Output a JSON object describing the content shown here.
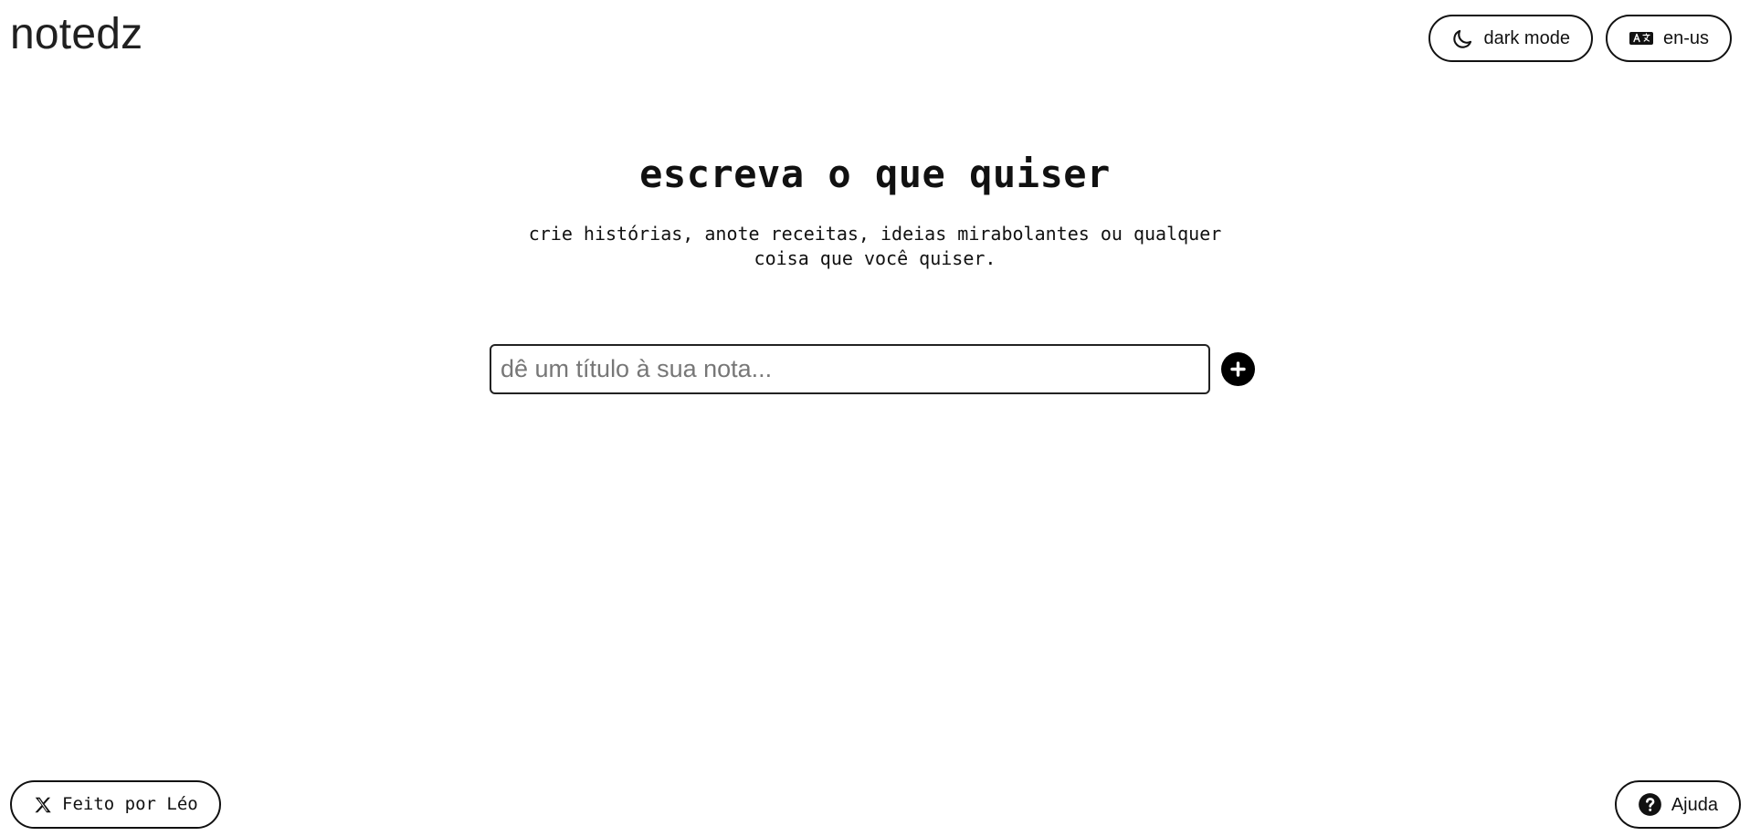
{
  "app": {
    "brand": "notedz"
  },
  "top_actions": {
    "dark_mode": {
      "label": "dark mode",
      "icon": "moon-icon"
    },
    "language": {
      "label": "en-us",
      "icon": "translate-icon"
    }
  },
  "hero": {
    "title": "escreva o que quiser",
    "subtitle": "crie histórias, anote receitas, ideias mirabolantes ou qualquer coisa que você quiser."
  },
  "note_form": {
    "title_input": {
      "value": "",
      "placeholder": "dê um título à sua nota..."
    },
    "add_button": {
      "icon": "plus-icon",
      "aria_label": "Add note"
    }
  },
  "footer": {
    "credit": {
      "label": "Feito por Léo",
      "icon": "x-logo-icon"
    },
    "help": {
      "label": "Ajuda",
      "icon": "question-circle-icon"
    }
  },
  "colors": {
    "background": "#ffffff",
    "text": "#111111",
    "border": "#111111",
    "accent": "#000000"
  }
}
